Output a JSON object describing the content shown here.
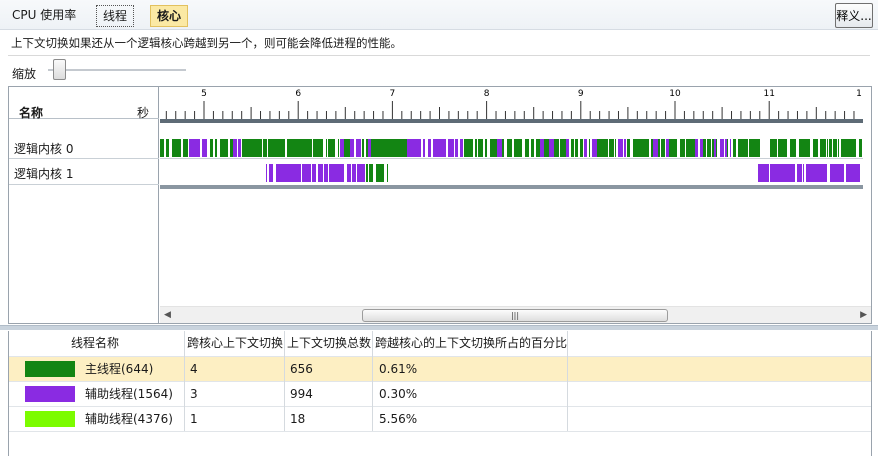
{
  "tabs": {
    "cpu": "CPU 使用率",
    "threads": "线程",
    "cores": "核心",
    "explain": "释义..."
  },
  "description": "上下文切换如果还从一个逻辑核心跨越到另一个，则可能会降低进程的性能。",
  "zoom": {
    "label": "缩放",
    "level": 0.05
  },
  "timeline": {
    "header": {
      "name": "名称",
      "seconds": "秒"
    },
    "ticks": [
      "5",
      "6",
      "7",
      "8",
      "9",
      "10",
      "11",
      "1"
    ],
    "cores": [
      "逻辑内核 0",
      "逻辑内核 1"
    ],
    "scroll_grip": "|||"
  },
  "table": {
    "headers": [
      "线程名称",
      "跨核心上下文切换",
      "上下文切换总数",
      "跨越核心的上下文切换所占的百分比"
    ],
    "rows": [
      {
        "name": "主线程(644)",
        "cross": "4",
        "total": "656",
        "pct": "0.61%",
        "color": "#138513"
      },
      {
        "name": "辅助线程(1564)",
        "cross": "3",
        "total": "994",
        "pct": "0.30%",
        "color": "#8a2be2"
      },
      {
        "name": "辅助线程(4376)",
        "cross": "1",
        "total": "18",
        "pct": "5.56%",
        "color": "#7cfc00"
      }
    ]
  },
  "colors": {
    "main_thread": "#138513",
    "worker_purple": "#8a2be2",
    "worker_lime": "#7cfc00",
    "selected_row": "#fdefc3",
    "active_tab": "#fbe9a4"
  }
}
